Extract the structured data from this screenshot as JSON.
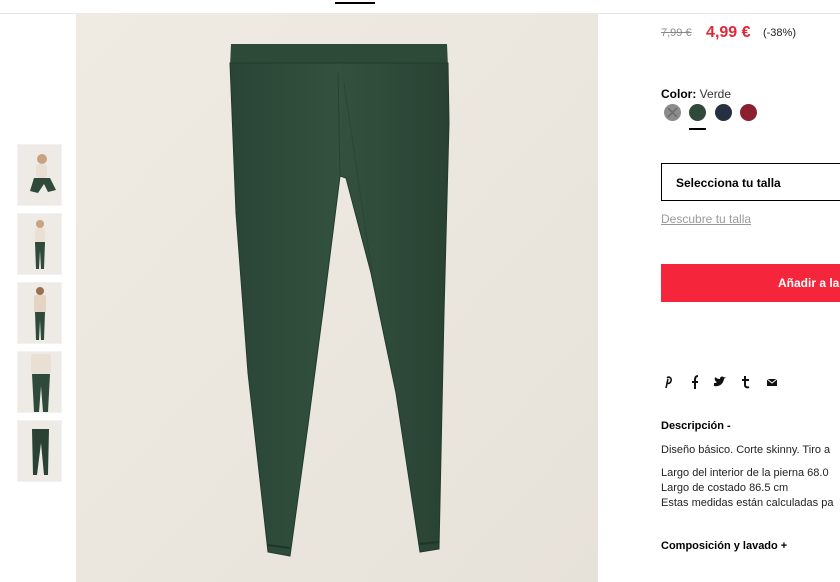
{
  "price": {
    "original": "7,99 €",
    "current": "4,99 €",
    "discount": "(-38%)"
  },
  "color": {
    "label": "Color:",
    "selected": "Verde",
    "swatches": [
      {
        "name": "gris",
        "hex": "#8c8c8c"
      },
      {
        "name": "verde",
        "hex": "#2f4a3a"
      },
      {
        "name": "azul-marino",
        "hex": "#253040"
      },
      {
        "name": "granate",
        "hex": "#8a2030"
      }
    ]
  },
  "size": {
    "placeholder": "Selecciona tu talla",
    "guide_link": "Descubre tu talla"
  },
  "cart": {
    "add_label": "Añadir a la"
  },
  "share": {
    "icons": [
      "pinterest-icon",
      "facebook-icon",
      "twitter-icon",
      "tumblr-icon",
      "email-icon"
    ]
  },
  "description": {
    "title": "Descripción -",
    "lines": [
      "Diseño básico. Corte skinny. Tiro a",
      "Largo del interior de la pierna 68.0",
      "Largo de costado 86.5 cm",
      "Estas medidas están calculadas pa"
    ]
  },
  "composition": {
    "title": "Composición y lavado +"
  },
  "colors": {
    "accent": "#e32636",
    "button": "#f5253c",
    "product": "#2f4a3a"
  }
}
